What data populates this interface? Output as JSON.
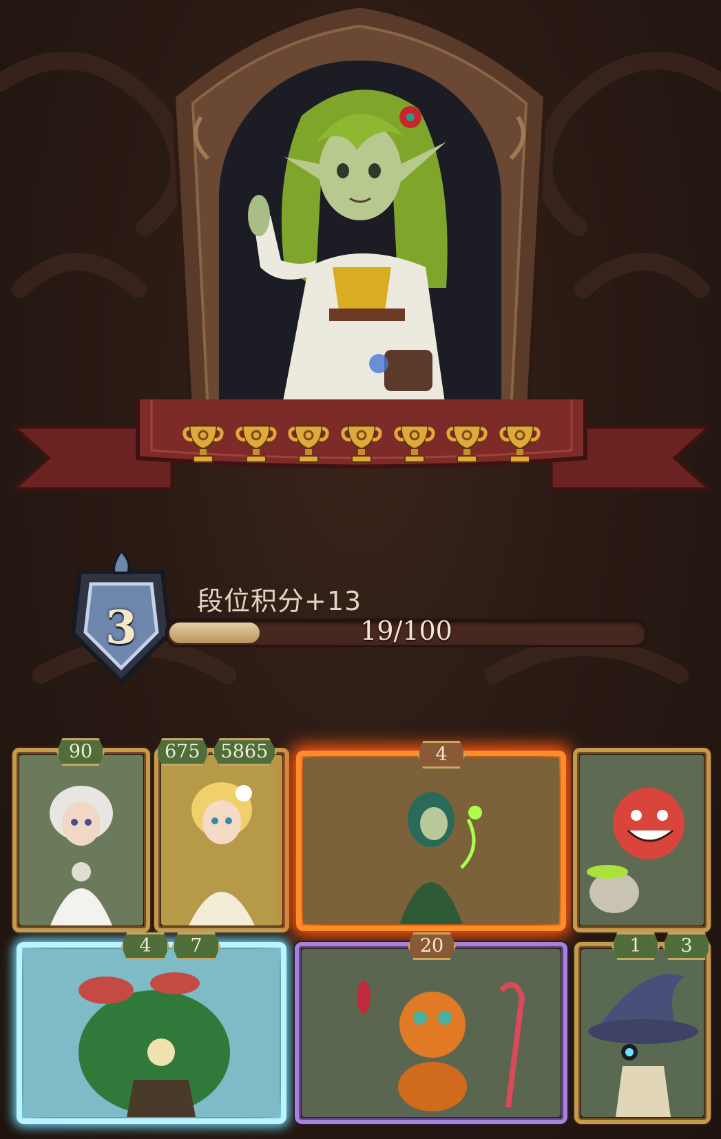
{
  "hero": {
    "name_icon": "elf-girl-portrait",
    "trophies": [
      {
        "icon": "trophy-icon"
      },
      {
        "icon": "trophy-icon"
      },
      {
        "icon": "trophy-icon"
      },
      {
        "icon": "trophy-icon"
      },
      {
        "icon": "trophy-icon"
      },
      {
        "icon": "trophy-icon"
      },
      {
        "icon": "trophy-icon"
      }
    ]
  },
  "rank": {
    "level": "3",
    "points_label": "段位积分+13",
    "progress_text": "19/100",
    "progress_fraction": 0.19
  },
  "cards": [
    {
      "id": "white-flower-fairy",
      "badges": [
        "90"
      ],
      "style": "gold"
    },
    {
      "id": "golden-bloom-fairy",
      "badges": [
        "675",
        "5865"
      ],
      "style": "gold"
    },
    {
      "id": "forest-dryad",
      "badges": [
        "4"
      ],
      "style": "fire"
    },
    {
      "id": "red-imp",
      "badges": [],
      "style": "gold"
    },
    {
      "id": "mushroom-treant",
      "badges": [
        "4",
        "7"
      ],
      "style": "ice"
    },
    {
      "id": "pumpkin-candy-jester",
      "badges": [
        "20"
      ],
      "style": "purple"
    },
    {
      "id": "wizard-hat-creature",
      "badges": [
        "1",
        "3"
      ],
      "style": "gold"
    }
  ],
  "colors": {
    "accent_gold": "#c69a4d",
    "badge_green": "#4f6e3a",
    "ribbon_red": "#7a2a27",
    "background": "#2a1a14"
  }
}
